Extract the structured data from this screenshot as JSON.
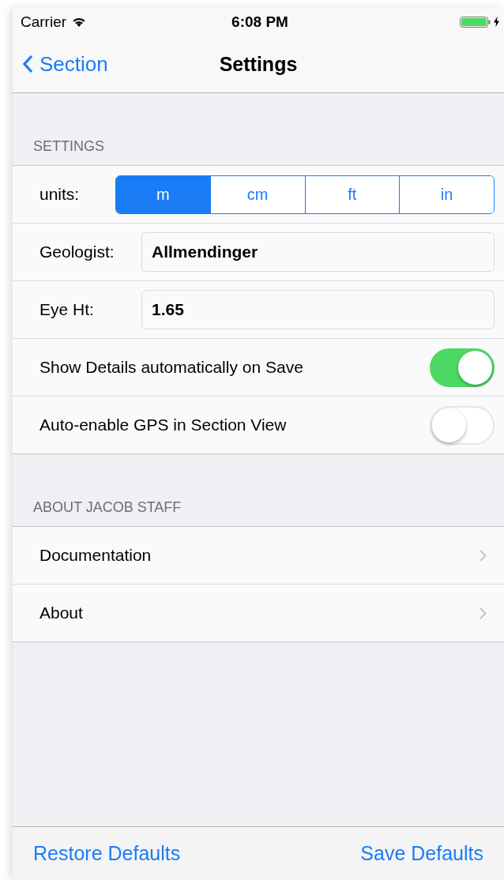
{
  "status_bar": {
    "carrier": "Carrier",
    "time": "6:08 PM"
  },
  "nav": {
    "back": "Section",
    "title": "Settings"
  },
  "sections": [
    {
      "header": "SETTINGS",
      "rows": [
        {
          "kind": "segmented",
          "label": "units:",
          "segments": [
            {
              "label": "m",
              "selected": true
            },
            {
              "label": "cm",
              "selected": false
            },
            {
              "label": "ft",
              "selected": false
            },
            {
              "label": "in",
              "selected": false
            }
          ]
        },
        {
          "kind": "field",
          "label": "Geologist:",
          "value": "Allmendinger"
        },
        {
          "kind": "field",
          "label": "Eye Ht:",
          "value": "1.65"
        },
        {
          "kind": "switch",
          "label": "Show Details automatically on Save",
          "on": true
        },
        {
          "kind": "switch",
          "label": "Auto-enable GPS in Section View",
          "on": false
        }
      ]
    },
    {
      "header": "ABOUT JACOB STAFF",
      "rows": [
        {
          "kind": "link",
          "label": "Documentation"
        },
        {
          "kind": "link",
          "label": "About"
        }
      ]
    }
  ],
  "toolbar": {
    "buttons": [
      "Restore Defaults",
      "Save Defaults"
    ]
  }
}
